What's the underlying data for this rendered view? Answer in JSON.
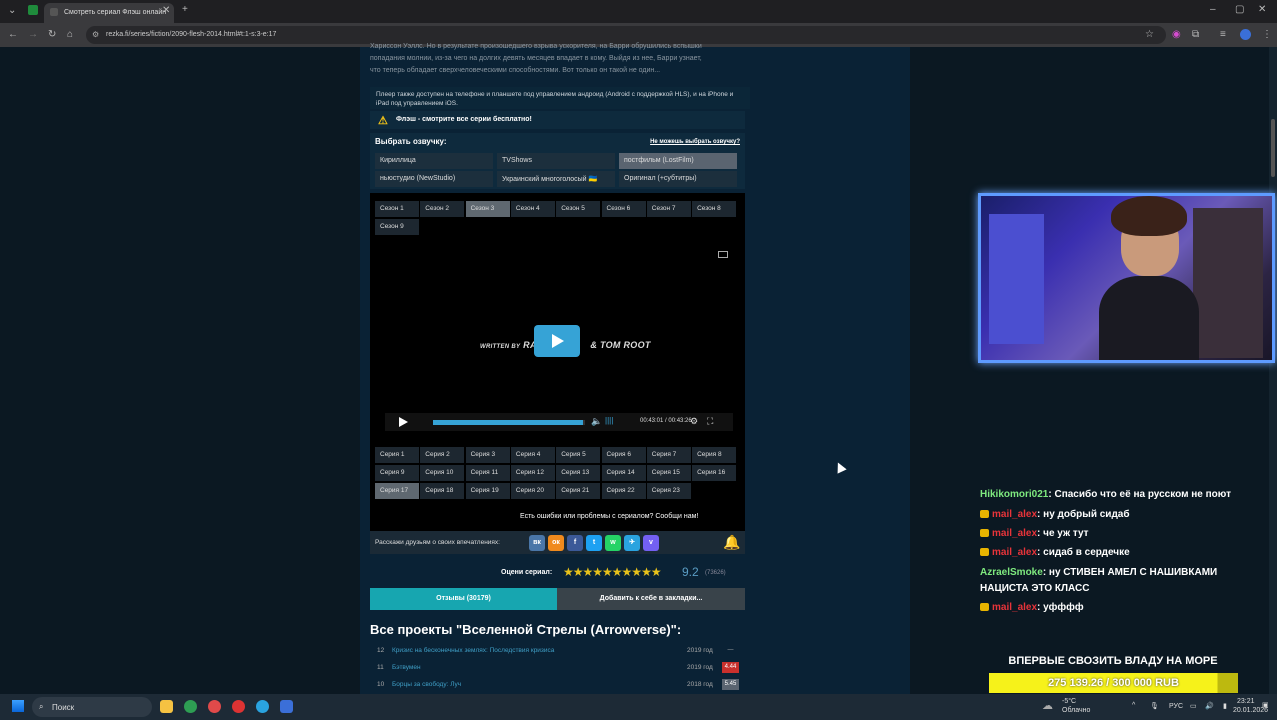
{
  "browser": {
    "tab_title": "Смотреть сериал Флэш онлайн",
    "url": "rezka.fi/series/fiction/2090-flesh-2014.html#t:1-s:3-e:17"
  },
  "page": {
    "desc_line1": "Хариссон Уэллс. Но в результате произошедшего взрыва ускорителя, на Барри обрушились вспышки",
    "desc_line2": "попадания молнии, из-за чего на долгих девять месяцев впадает в кому. Выйдя из нее, Барри узнает,",
    "desc_line3": "что теперь обладает сверхчеловеческими способностями. Вот только он такой не один...",
    "phone_info": "Плеер также доступен на телефоне и планшете под управлением андроид (Android с поддержкой HLS), и на iPhone и iPad под управлением iOS.",
    "warning": "Флэш - смотрите все серии бесплатно!",
    "translator_title": "Выбрать озвучку:",
    "translator_help": "Не можешь выбрать озвучку?",
    "translators": [
      {
        "label": "Кириллица"
      },
      {
        "label": "TVShows"
      },
      {
        "label": "постфильм (LostFilm)"
      },
      {
        "label": "ньюстудио (NewStudio)"
      },
      {
        "label": "Украинский многоголосый 🇺🇦"
      },
      {
        "label": "Оригинал (+субтитры)"
      }
    ],
    "active_translator": "постфильм (LostFilm)",
    "seasons": [
      "Сезон 1",
      "Сезон 2",
      "Сезон 3",
      "Сезон 4",
      "Сезон 5",
      "Сезон 6",
      "Сезон 7",
      "Сезон 8",
      "Сезон 9"
    ],
    "active_season": "Сезон 3",
    "player": {
      "credits_prefix": "WRITTEN BY",
      "credits_text": "RAC",
      "credits_suffix": "& TOM ROOT",
      "time": "00:43:01 / 00:43:26",
      "progress": 0.99
    },
    "episodes": [
      "Серия 1",
      "Серия 2",
      "Серия 3",
      "Серия 4",
      "Серия 5",
      "Серия 6",
      "Серия 7",
      "Серия 8",
      "Серия 9",
      "Серия 10",
      "Серия 11",
      "Серия 12",
      "Серия 13",
      "Серия 14",
      "Серия 15",
      "Серия 16",
      "Серия 17",
      "Серия 18",
      "Серия 19",
      "Серия 20",
      "Серия 21",
      "Серия 22",
      "Серия 23"
    ],
    "active_episode": "Серия 17",
    "error_text": "Есть ошибки или проблемы с сериалом? Сообщи нам!",
    "share_label": "Расскажи друзьям о своих впечатлениях:",
    "share_buttons": [
      {
        "icon": "vk-icon",
        "text": "вк",
        "color": "#4a76a8"
      },
      {
        "icon": "ok-icon",
        "text": "ок",
        "color": "#f08a1d"
      },
      {
        "icon": "facebook-icon",
        "text": "f",
        "color": "#3b5998"
      },
      {
        "icon": "twitter-icon",
        "text": "t",
        "color": "#1da1f2"
      },
      {
        "icon": "whatsapp-icon",
        "text": "w",
        "color": "#25d366"
      },
      {
        "icon": "telegram-icon",
        "text": "✈",
        "color": "#2aa3df"
      },
      {
        "icon": "viber-icon",
        "text": "v",
        "color": "#7360f2"
      }
    ],
    "rating_label": "Оцени сериал:",
    "rating_value": "9.2",
    "rating_count": "(73626)",
    "stars": "★★★★★★★★★★",
    "reviews_tab": "Отзывы (30179)",
    "bookmark_tab": "Добавить к себе в закладки...",
    "franchise_title": "Все проекты \"Вселенной Стрелы (Arrowverse)\":",
    "franchise": [
      {
        "num": "12",
        "title": "Кризис на бесконечных землях: Последствия кризиса",
        "year": "2019 год",
        "rating": "—",
        "color": ""
      },
      {
        "num": "11",
        "title": "Бэтвумен",
        "year": "2019 год",
        "rating": "4.44",
        "color": "#c9302c"
      },
      {
        "num": "10",
        "title": "Борцы за свободу: Луч",
        "year": "2018 год",
        "rating": "5.45",
        "color": "#5a6470"
      }
    ]
  },
  "chat": [
    {
      "nick": "Hikikomori021",
      "msg": ": Спасибо что её на русском не поют",
      "badge": false,
      "nick_color": "green"
    },
    {
      "nick": "mail_alex",
      "msg": ": ну добрый сидаб",
      "badge": true,
      "nick_color": "red"
    },
    {
      "nick": "mail_alex",
      "msg": ": че уж тут",
      "badge": true,
      "nick_color": "red"
    },
    {
      "nick": "mail_alex",
      "msg": ": сидаб в сердечке",
      "badge": true,
      "nick_color": "red"
    },
    {
      "nick": "AzraelSmoke",
      "msg": ": ну СТИВЕН АМЕЛ С НАШИВКАМИ",
      "badge": false,
      "nick_color": "green"
    },
    {
      "nick": "",
      "msg": "НАЦИСТА ЭТО КЛАСС",
      "badge": false,
      "nick_color": "green"
    },
    {
      "nick": "mail_alex",
      "msg": ": уфффф",
      "badge": true,
      "nick_color": "red"
    }
  ],
  "stream": {
    "promo": "ВПЕРВЫЕ СВОЗИТЬ ВЛАДУ НА МОРЕ",
    "donation": "275 139.26 / 300 000 RUB",
    "donation_fraction": 0.917
  },
  "taskbar": {
    "search": "Поиск",
    "weather_temp": "-5°C",
    "weather_text": "Облачно",
    "lang": "РУС",
    "time": "23:21",
    "date": "20.01.2026"
  }
}
